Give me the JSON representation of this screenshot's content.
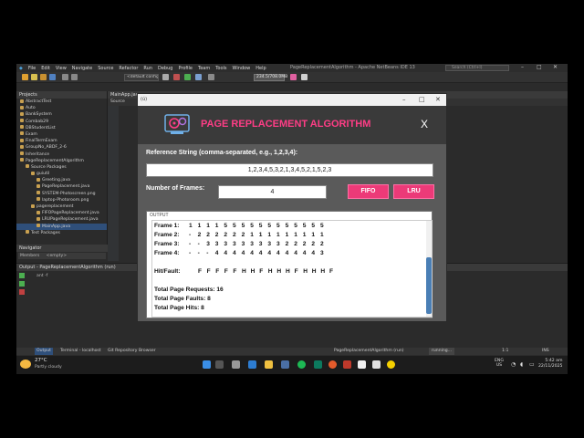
{
  "ide": {
    "title": "PageReplacementAlgorithm - Apache NetBeans IDE 13",
    "menu": [
      "File",
      "Edit",
      "View",
      "Navigate",
      "Source",
      "Refactor",
      "Run",
      "Debug",
      "Profile",
      "Team",
      "Tools",
      "Window",
      "Help"
    ],
    "search_placeholder": "Search (Ctrl+I)",
    "config_select": "<default config>",
    "memory": "234.5/708.0MB",
    "projects_header": "Projects",
    "editor_tab": "MainApp.java",
    "editor_subtab": "Source",
    "tree": [
      "AbstractTest",
      "Auto",
      "BankSystem",
      "Combab29",
      "DBStudentList",
      "Exam",
      "FinalTermExam",
      "GroupNo_ABDF_2-6",
      "Inheritance",
      "PageReplacementAlgorithm",
      "Source Packages",
      "guiutil",
      "Greeting.java",
      "PageReplacement.java",
      "SYSTEM-Photoscreen.png",
      "laptop-Photoroom.png",
      "pagereplacement",
      "FIFOPageReplacement.java",
      "LRUPageReplacement.java",
      "MainApp.java",
      "Test Packages"
    ],
    "selected_tree_index": 19,
    "navigator_header": "Navigator",
    "navigator_members": "Members",
    "navigator_filter": "<empty>",
    "output_header": "Output - PageReplacementAlgorithm (run)",
    "output_text": "ant -f",
    "status_left_tabs": [
      "Output",
      "Terminal - localhost",
      "Git Repository Browser"
    ],
    "status_center": "PageReplacementAlgorithm (run)",
    "status_run": "running...",
    "status_pos": "1:1",
    "status_ins": "INS"
  },
  "taskbar": {
    "weather_temp": "27°C",
    "weather_desc": "Partly cloudy",
    "lang": "ENG",
    "region": "US",
    "time": "5:42 am",
    "date": "22/11/2025"
  },
  "app": {
    "window_icon": "(ú)",
    "title": "PAGE REPLACEMENT ALGORITHM",
    "close_label": "X",
    "reference_label": "Reference String (comma-separated, e.g., 1,2,3,4):",
    "reference_value": "1,2,3,4,5,3,2,1,3,4,5,2,1,5,2,3",
    "frames_label": "Number of Frames:",
    "frames_value": "4",
    "fifo_label": "FIFO",
    "lru_label": "LRU",
    "output_title": "OUTPUT",
    "frame_rows": [
      {
        "label": "Frame 1:",
        "cells": [
          "1",
          "1",
          "1",
          "1",
          "5",
          "5",
          "5",
          "5",
          "5",
          "5",
          "5",
          "5",
          "5",
          "5",
          "5",
          "5"
        ]
      },
      {
        "label": "Frame 2:",
        "cells": [
          "-",
          "2",
          "2",
          "2",
          "2",
          "2",
          "2",
          "1",
          "1",
          "1",
          "1",
          "1",
          "1",
          "1",
          "1",
          "1"
        ]
      },
      {
        "label": "Frame 3:",
        "cells": [
          "-",
          "-",
          "3",
          "3",
          "3",
          "3",
          "3",
          "3",
          "3",
          "3",
          "3",
          "2",
          "2",
          "2",
          "2",
          "2"
        ]
      },
      {
        "label": "Frame 4:",
        "cells": [
          "-",
          "-",
          "-",
          "4",
          "4",
          "4",
          "4",
          "4",
          "4",
          "4",
          "4",
          "4",
          "4",
          "4",
          "4",
          "3"
        ]
      }
    ],
    "hitfault_label": "Hit/Fault:",
    "hitfault": [
      "F",
      "F",
      "F",
      "F",
      "F",
      "H",
      "H",
      "F",
      "H",
      "H",
      "H",
      "F",
      "H",
      "H",
      "H",
      "F"
    ],
    "total_requests": "Total Page Requests: 16",
    "total_faults": "Total Page Faults: 8",
    "total_hits": "Total Page Hits: 8",
    "accent_color": "#ec3a78",
    "title_color": "#ff3d86"
  }
}
